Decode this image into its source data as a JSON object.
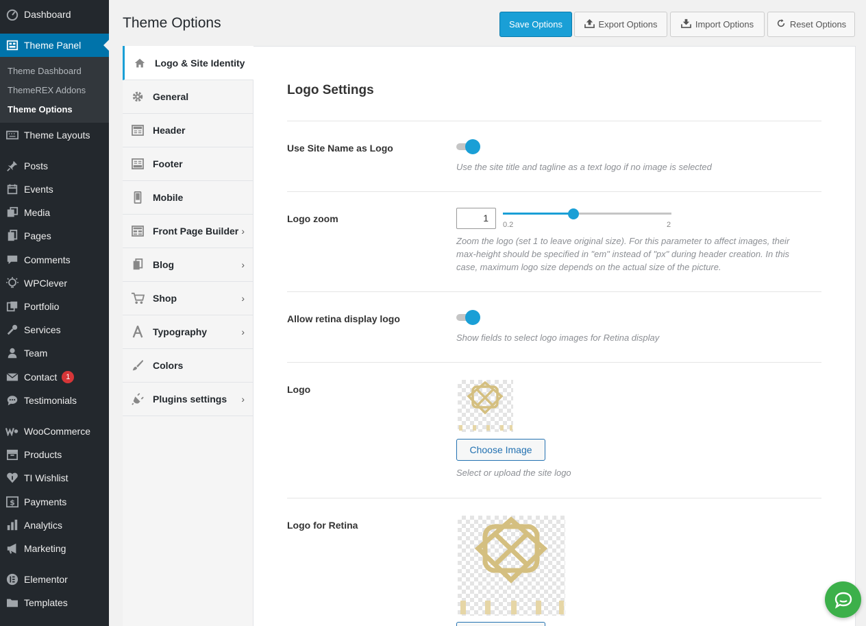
{
  "sidebar": {
    "items": [
      {
        "label": "Dashboard",
        "icon": "dashboard-icon"
      },
      {
        "label": "Theme Panel",
        "icon": "theme-panel-icon"
      },
      {
        "label": "Theme Layouts",
        "icon": "keyboard-icon"
      },
      {
        "label": "Posts",
        "icon": "pin-icon"
      },
      {
        "label": "Events",
        "icon": "events-icon"
      },
      {
        "label": "Media",
        "icon": "media-icon"
      },
      {
        "label": "Pages",
        "icon": "pages-icon"
      },
      {
        "label": "Comments",
        "icon": "comments-icon"
      },
      {
        "label": "WPClever",
        "icon": "bulb-icon"
      },
      {
        "label": "Portfolio",
        "icon": "portfolio-icon"
      },
      {
        "label": "Services",
        "icon": "wrench-icon"
      },
      {
        "label": "Team",
        "icon": "person-icon"
      },
      {
        "label": "Contact",
        "icon": "mail-icon",
        "badge": "1"
      },
      {
        "label": "Testimonials",
        "icon": "chat-icon"
      },
      {
        "label": "WooCommerce",
        "icon": "woo-icon"
      },
      {
        "label": "Products",
        "icon": "archive-icon"
      },
      {
        "label": "TI Wishlist",
        "icon": "heart-icon"
      },
      {
        "label": "Payments",
        "icon": "dollar-icon"
      },
      {
        "label": "Analytics",
        "icon": "bar-chart-icon"
      },
      {
        "label": "Marketing",
        "icon": "megaphone-icon"
      },
      {
        "label": "Elementor",
        "icon": "elementor-icon"
      },
      {
        "label": "Templates",
        "icon": "folder-icon"
      }
    ],
    "submenu": [
      {
        "label": "Theme Dashboard"
      },
      {
        "label": "ThemeREX Addons"
      },
      {
        "label": "Theme Options"
      }
    ]
  },
  "header": {
    "title": "Theme Options",
    "save_label": "Save Options",
    "export_label": "Export Options",
    "import_label": "Import Options",
    "reset_label": "Reset Options"
  },
  "tabs": [
    {
      "label": "Logo & Site Identity",
      "icon": "home-icon"
    },
    {
      "label": "General",
      "icon": "gear-icon"
    },
    {
      "label": "Header",
      "icon": "header-layout-icon"
    },
    {
      "label": "Footer",
      "icon": "footer-layout-icon"
    },
    {
      "label": "Mobile",
      "icon": "mobile-icon"
    },
    {
      "label": "Front Page Builder",
      "icon": "grid-icon",
      "has_children": true
    },
    {
      "label": "Blog",
      "icon": "copy-icon",
      "has_children": true
    },
    {
      "label": "Shop",
      "icon": "cart-icon",
      "has_children": true
    },
    {
      "label": "Typography",
      "icon": "font-icon",
      "has_children": true
    },
    {
      "label": "Colors",
      "icon": "brush-icon"
    },
    {
      "label": "Plugins settings",
      "icon": "plugin-icon",
      "has_children": true
    }
  ],
  "content": {
    "section_title": "Logo Settings",
    "options": {
      "use_site_name": {
        "label": "Use Site Name as Logo",
        "description": "Use the site title and tagline as a text logo if no image is selected",
        "enabled": true
      },
      "logo_zoom": {
        "label": "Logo zoom",
        "value": "1",
        "min": "0.2",
        "max": "2",
        "description_lines": [
          "Zoom the logo (set 1 to leave original size). For this parameter to affect images, their",
          "max-height should be specified in \"em\" instead of \"px\" during header creation. In this",
          "case, maximum logo size depends on the actual size of the picture."
        ]
      },
      "retina": {
        "label": "Allow retina display logo",
        "description": "Show fields to select logo images for Retina display",
        "enabled": true
      },
      "logo": {
        "label": "Logo",
        "button_label": "Choose Image",
        "description": "Select or upload the site logo"
      },
      "logo_retina": {
        "label": "Logo for Retina"
      }
    }
  },
  "colors": {
    "accent": "#1a9fd6",
    "sidebar_bg": "#23282d",
    "current_menu": "#0073aa",
    "logo_gold": "#d4bf80",
    "chat_green": "#3cb04a"
  }
}
